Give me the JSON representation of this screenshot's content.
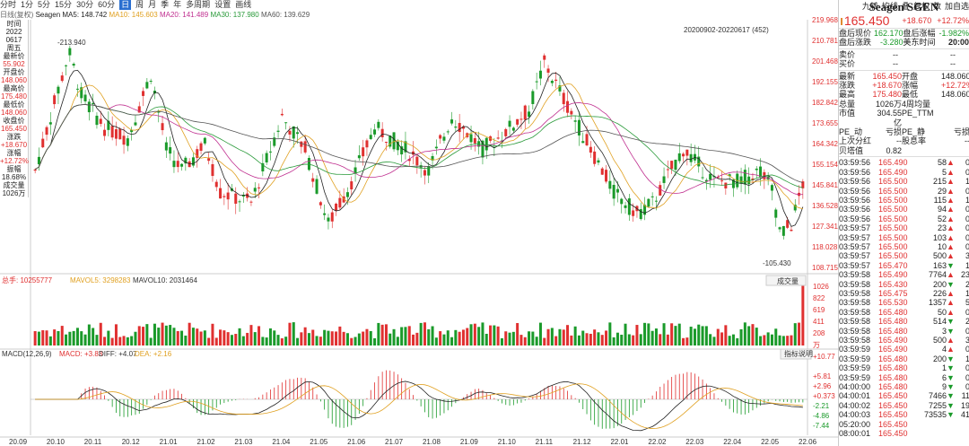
{
  "toolbar": {
    "periods": [
      "分时",
      "1分",
      "5分",
      "15分",
      "30分",
      "60分",
      "日",
      "周",
      "月",
      "季",
      "年",
      "多周期",
      "设置",
      "画线"
    ],
    "tools": [
      "九转",
      "均线",
      "叠",
      "复权",
      "数",
      "加自选"
    ]
  },
  "ma_line": {
    "title": "日线(复权)",
    "name": "Seagen",
    "ma5": "MA5: 148.742",
    "ma10": "MA10: 145.603",
    "ma20": "MA20: 141.489",
    "ma30": "MA30: 137.980",
    "ma60": "MA60: 139.629"
  },
  "range_label": "20200902-20220617 (452)",
  "info_panel": [
    {
      "k": "时间",
      "v": "2022"
    },
    {
      "k": "",
      "v": "0617"
    },
    {
      "k": "",
      "v": "周五"
    },
    {
      "k": "最新价",
      "v": "55.902",
      "c": "u"
    },
    {
      "k": "开盘价",
      "v": "148.060",
      "c": "u"
    },
    {
      "k": "最高价",
      "v": "175.480",
      "c": "u"
    },
    {
      "k": "最低价",
      "v": "148.060",
      "c": "u"
    },
    {
      "k": "收盘价",
      "v": "165.450",
      "c": "u"
    },
    {
      "k": "涨跌",
      "v": "+18.670",
      "c": "u"
    },
    {
      "k": "涨幅",
      "v": "+12.72%",
      "c": "u"
    },
    {
      "k": "振幅",
      "v": "18.68%"
    },
    {
      "k": "成交量",
      "v": "1026万"
    }
  ],
  "price_axis": [
    "219.968",
    "210.781",
    "201.468",
    "192.155",
    "182.842",
    "173.655",
    "164.342",
    "155.154",
    "145.841",
    "136.528",
    "127.341",
    "118.028",
    "108.715"
  ],
  "annot": {
    "high": "213.940",
    "low": "105.430"
  },
  "vol_line": {
    "total": "总手: 10255777",
    "mavol5": "MAVOL5: 3298283",
    "mavol10": "MAVOL10: 2031464",
    "btn": "成交量"
  },
  "vol_axis": [
    "1026",
    "822",
    "619",
    "411",
    "208",
    "万"
  ],
  "macd_line": {
    "title": "MACD(12,26,9)",
    "macd": "MACD: +3.83",
    "diff": "DIFF: +4.07",
    "dea": "DEA: +2.16",
    "btn": "指标说明"
  },
  "macd_axis": [
    "+10.77",
    "55.902",
    "+5.81",
    "+2.96",
    "+0.373",
    "-2.21",
    "-4.86",
    "-7.44"
  ],
  "x_dates": [
    "20.09",
    "20.10",
    "20.11",
    "20.12",
    "21.01",
    "21.02",
    "21.03",
    "21.04",
    "21.05",
    "21.06",
    "21.07",
    "21.08",
    "21.09",
    "21.10",
    "21.11",
    "21.12",
    "22.01",
    "22.02",
    "22.03",
    "22.04",
    "22.05",
    "22.06"
  ],
  "quote": {
    "name": "Seagen SGEN",
    "price": "165.450",
    "chg": "+18.670",
    "pct": "+12.72%",
    "ah_price_lbl": "盘后现价",
    "ah_price": "162.170",
    "ah_pct_lbl": "盘后涨幅",
    "ah_pct": "-1.982%",
    "ah_chg_lbl": "盘后涨跌",
    "ah_chg": "-3.280",
    "time_lbl": "美东时间",
    "time": "20:00",
    "sell": "卖价",
    "buy": "买价",
    "dash": "--",
    "rows": [
      [
        "最新",
        "165.450",
        "开盘",
        "148.060"
      ],
      [
        "涨跌",
        "+18.670",
        "涨幅",
        "+12.72%"
      ],
      [
        "最高",
        "175.480",
        "最低",
        "148.060"
      ],
      [
        "总量",
        "1026万",
        "4周均量",
        ""
      ],
      [
        "市值",
        "304.55亿",
        "PE_TTM",
        ""
      ],
      [
        "PE_动",
        "亏损",
        "PE_静",
        "亏损"
      ],
      [
        "上次分红",
        "--",
        "股息率",
        "--"
      ],
      [
        "贝塔值",
        "0.82",
        "",
        ""
      ]
    ]
  },
  "trades": [
    [
      "03:59:56",
      "165.490",
      "58",
      "u",
      "0"
    ],
    [
      "03:59:56",
      "165.490",
      "5",
      "u",
      "0"
    ],
    [
      "03:59:56",
      "165.500",
      "215",
      "u",
      "1"
    ],
    [
      "03:59:56",
      "165.500",
      "29",
      "u",
      "0"
    ],
    [
      "03:59:56",
      "165.500",
      "115",
      "u",
      "1"
    ],
    [
      "03:59:56",
      "165.500",
      "94",
      "u",
      "0"
    ],
    [
      "03:59:56",
      "165.500",
      "52",
      "u",
      "0"
    ],
    [
      "03:59:57",
      "165.500",
      "23",
      "u",
      "0"
    ],
    [
      "03:59:57",
      "165.500",
      "103",
      "u",
      "0"
    ],
    [
      "03:59:57",
      "165.500",
      "10",
      "u",
      "0"
    ],
    [
      "03:59:57",
      "165.500",
      "500",
      "u",
      "3"
    ],
    [
      "03:59:57",
      "165.470",
      "163",
      "d",
      "1"
    ],
    [
      "03:59:58",
      "165.490",
      "7764",
      "u",
      "23"
    ],
    [
      "03:59:58",
      "165.430",
      "200",
      "d",
      "2"
    ],
    [
      "03:59:58",
      "165.475",
      "226",
      "u",
      "1"
    ],
    [
      "03:59:58",
      "165.530",
      "1357",
      "u",
      "5"
    ],
    [
      "03:59:58",
      "165.480",
      "50",
      "u",
      "0"
    ],
    [
      "03:59:58",
      "165.480",
      "514",
      "d",
      "2"
    ],
    [
      "03:59:58",
      "165.480",
      "3",
      "d",
      "0"
    ],
    [
      "03:59:58",
      "165.490",
      "500",
      "u",
      "3"
    ],
    [
      "03:59:59",
      "165.490",
      "4",
      "u",
      "0"
    ],
    [
      "03:59:59",
      "165.480",
      "200",
      "d",
      "1"
    ],
    [
      "03:59:59",
      "165.480",
      "1",
      "d",
      "0"
    ],
    [
      "03:59:59",
      "165.480",
      "6",
      "d",
      "0"
    ],
    [
      "04:00:00",
      "165.480",
      "9",
      "d",
      "0"
    ],
    [
      "04:00:01",
      "165.450",
      "7466",
      "d",
      "11"
    ],
    [
      "04:00:02",
      "165.450",
      "7255",
      "d",
      "19"
    ],
    [
      "04:00:03",
      "165.450",
      "73535",
      "d",
      "41"
    ],
    [
      "05:20:00",
      "165.450",
      "",
      "",
      ""
    ],
    [
      "08:00:01",
      "165.450",
      "",
      "",
      ""
    ]
  ],
  "colors": {
    "up": "#e03030",
    "down": "#1a9a2a",
    "ma5": "#222222",
    "ma10": "#e0a020",
    "ma20": "#c03090",
    "ma30": "#2a9a3a",
    "ma60": "#555555"
  }
}
